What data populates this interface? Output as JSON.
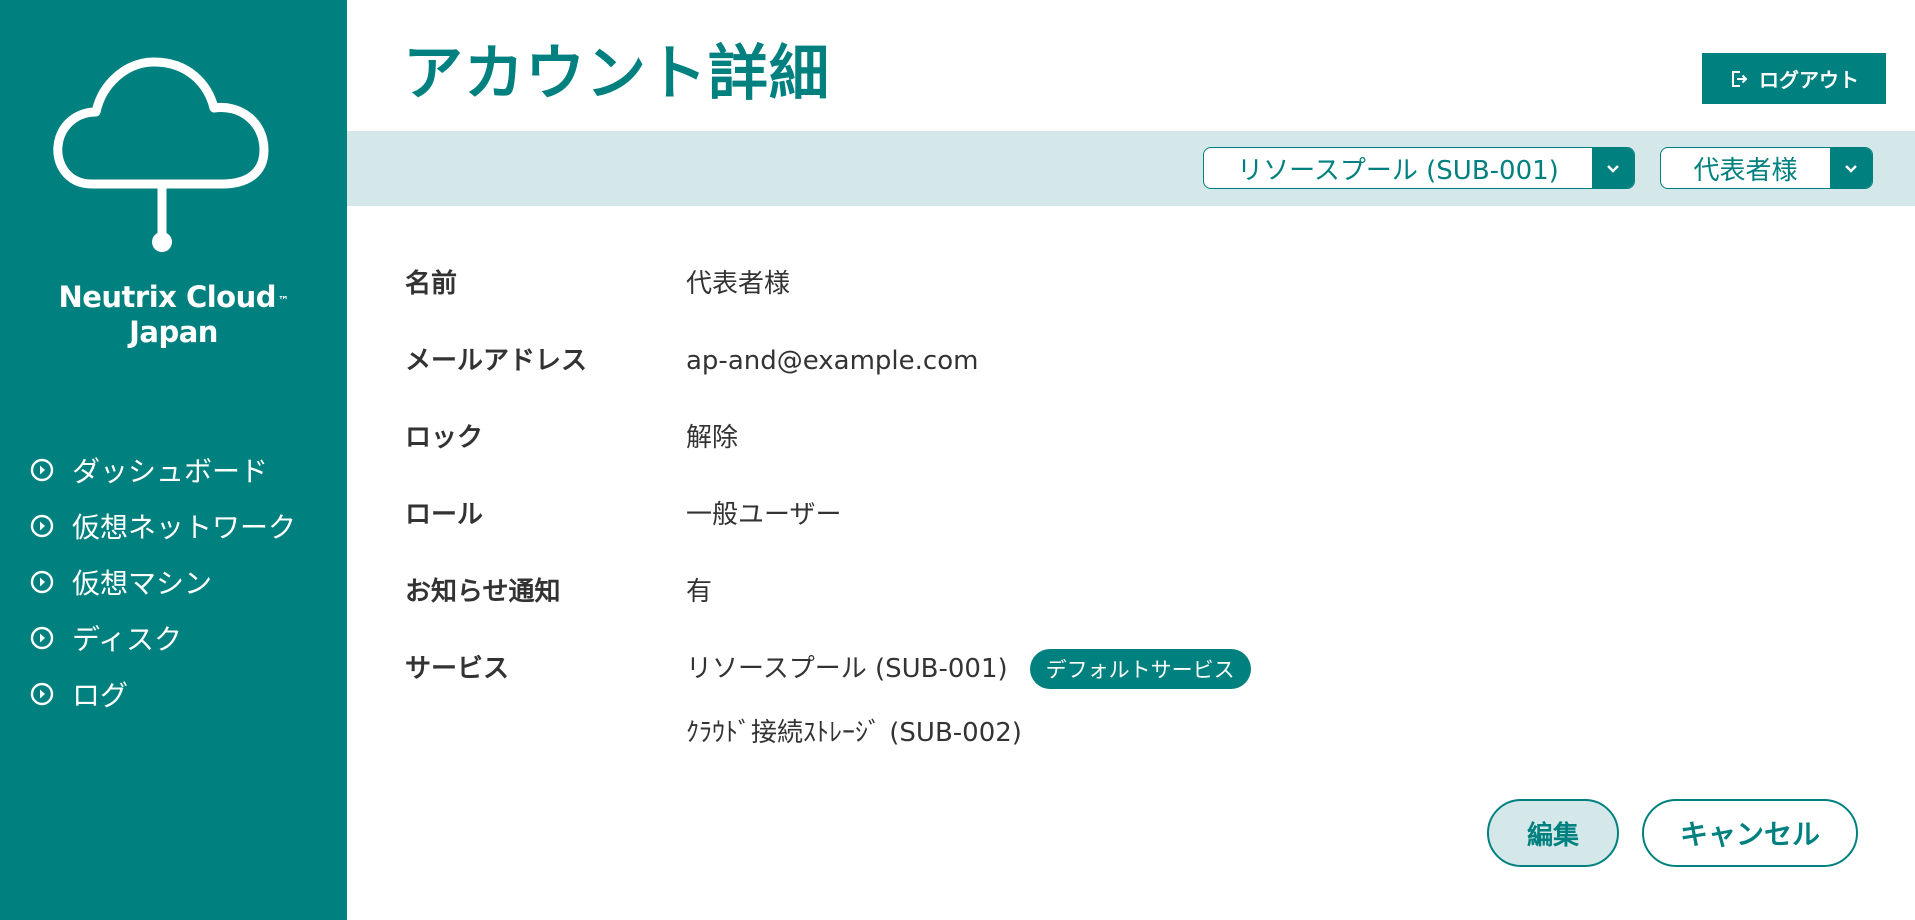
{
  "brand": {
    "line1": "Neutrix Cloud",
    "tm": "™",
    "line2": "Japan"
  },
  "sidebar": {
    "items": [
      {
        "label": "ダッシュボード"
      },
      {
        "label": "仮想ネットワーク"
      },
      {
        "label": "仮想マシン"
      },
      {
        "label": "ディスク"
      },
      {
        "label": "ログ"
      }
    ]
  },
  "header": {
    "title": "アカウント詳細",
    "logout_label": "ログアウト"
  },
  "filters": {
    "service_selected": "リソースプール (SUB-001)",
    "user_selected": "代表者様"
  },
  "details": {
    "name": {
      "label": "名前",
      "value": "代表者様"
    },
    "email": {
      "label": "メールアドレス",
      "value": "ap-and@example.com"
    },
    "lock": {
      "label": "ロック",
      "value": "解除"
    },
    "role": {
      "label": "ロール",
      "value": "一般ユーザー"
    },
    "notification": {
      "label": "お知らせ通知",
      "value": "有"
    },
    "services": {
      "label": "サービス",
      "items": [
        {
          "name": "リソースプール (SUB-001)",
          "badge": "デフォルトサービス"
        },
        {
          "name": "ｸﾗｳﾄﾞ接続ｽﾄﾚｰｼﾞ (SUB-002)"
        }
      ]
    }
  },
  "actions": {
    "edit_label": "編集",
    "cancel_label": "キャンセル"
  },
  "colors": {
    "primary": "#00807e",
    "filter_bar": "#d4e8ea",
    "text": "#333333",
    "background": "#ffffff"
  },
  "icons": {
    "logo": "cloud-network-icon",
    "nav": "circle-arrow-right-icon",
    "logout": "logout-icon",
    "dropdown": "chevron-down-icon"
  }
}
